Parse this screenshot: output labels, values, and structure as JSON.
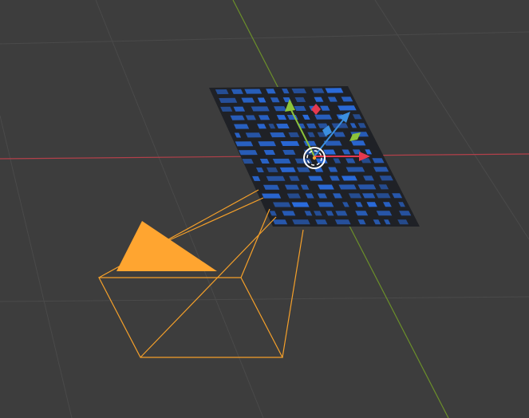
{
  "viewport": {
    "background": "#3d3d3d",
    "grid_color": "#4a4a4a",
    "x_axis_color": "#b3404a",
    "y_axis_color": "#6b8f2a"
  },
  "camera": {
    "selected": true,
    "outline_color": "#f5a02a",
    "up_triangle_color": "#ffa530"
  },
  "image_plane": {
    "base_color": "#1f2126",
    "pattern_color": "#2a6bdc"
  },
  "gizmo": {
    "x_arrow_color": "#e5394f",
    "y_arrow_color": "#8cc43a",
    "z_arrow_color": "#3b8fe0",
    "plane_xy_color": "#3b8fe0",
    "plane_yz_color": "#e5394f",
    "plane_xz_color": "#8cc43a",
    "center_ring_color": "#ffffff",
    "icons": [
      "move-gizmo-x-arrow",
      "move-gizmo-y-arrow",
      "move-gizmo-z-arrow",
      "move-gizmo-center-ring"
    ]
  }
}
